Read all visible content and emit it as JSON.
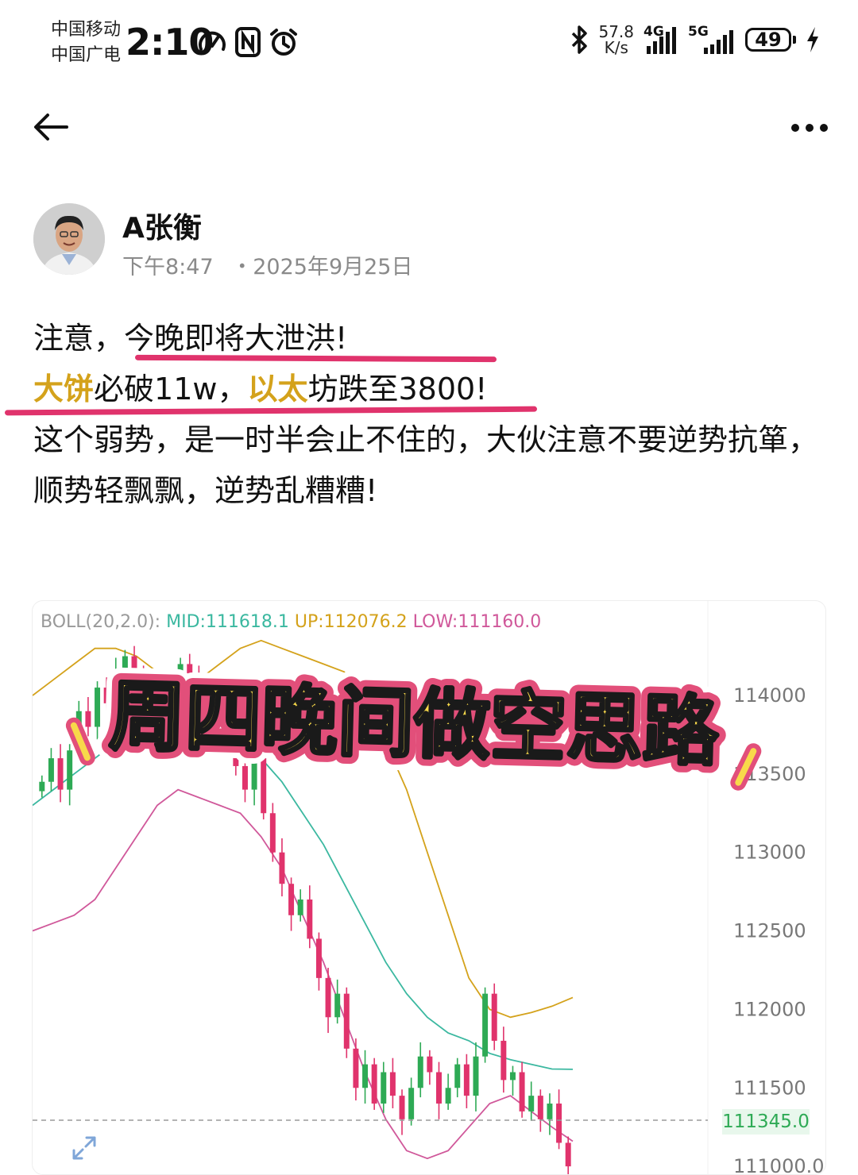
{
  "status_bar": {
    "carrier1": "中国移动",
    "carrier2": "中国广电",
    "time": "2:10",
    "net_speed_value": "57.8",
    "net_speed_unit": "K/s",
    "signal1_label": "4G",
    "signal2_label": "5G",
    "battery": "49"
  },
  "post": {
    "author": "A张衡",
    "time": "下午8:47",
    "date": "・2025年9月25日",
    "line1": "注意，今晚即将大泄洪!",
    "line2_hl1": "大饼",
    "line2_a": "必破11w，",
    "line2_hl2": "以太",
    "line2_b": "坊跌至3800!",
    "line3": "这个弱势，是一时半会止不住的，大伙注意不要逆势抗箪，",
    "line4": "顺势轻飘飘，逆势乱糟糟!"
  },
  "chart": {
    "boll_label": "BOLL(20,2.0):",
    "mid_label": "MID:111618.1",
    "up_label": "UP:112076.2",
    "low_label": "LOW:111160.0",
    "banner_text": "周四晚间做空思路",
    "current_price": "111345.0",
    "colors": {
      "mid": "#3bb8a0",
      "up": "#d4a21b",
      "low": "#d0589a",
      "rise": "#2eaa55",
      "fall": "#e0336c"
    }
  },
  "chart_data": {
    "type": "candlestick",
    "y_axis_ticks": [
      "114000",
      "113500",
      "113000",
      "112500",
      "112000",
      "111500",
      "111000.0"
    ],
    "ylim": [
      110950,
      114450
    ],
    "current_price": 111345.0,
    "boll": {
      "period": 20,
      "k": 2.0,
      "mid": 111618.1,
      "up": 112076.2,
      "low": 111160.0
    },
    "close": [
      113450,
      113600,
      113400,
      113650,
      113900,
      113800,
      114050,
      113950,
      114150,
      114250,
      114100,
      113900,
      114050,
      113850,
      113950,
      114200,
      114100,
      113800,
      113900,
      113750,
      113650,
      113550,
      113400,
      113600,
      113250,
      113000,
      112800,
      112600,
      112700,
      112450,
      112200,
      111950,
      112100,
      111750,
      111500,
      111650,
      111400,
      111600,
      111450,
      111300,
      111500,
      111700,
      111600,
      111400,
      111500,
      111650,
      111450,
      111700,
      112100,
      111800,
      111550,
      111600,
      111350,
      111450,
      111300,
      111400,
      111150,
      111000
    ],
    "up_band": [
      114000,
      114100,
      114200,
      114300,
      114300,
      114250,
      114150,
      114050,
      114100,
      114200,
      114300,
      114350,
      114300,
      114250,
      114200,
      114150,
      114000,
      113700,
      113400,
      113000,
      112600,
      112200,
      112000,
      111950,
      111980,
      112020,
      112076
    ],
    "mid_band": [
      113300,
      113400,
      113500,
      113600,
      113700,
      113750,
      113800,
      113800,
      113780,
      113750,
      113700,
      113600,
      113450,
      113250,
      113050,
      112800,
      112550,
      112300,
      112100,
      111950,
      111850,
      111800,
      111720,
      111680,
      111650,
      111620,
      111618
    ],
    "low_band": [
      112500,
      112550,
      112600,
      112700,
      112900,
      113100,
      113300,
      113400,
      113350,
      113300,
      113250,
      113100,
      112900,
      112600,
      112300,
      111950,
      111600,
      111300,
      111100,
      111050,
      111100,
      111250,
      111400,
      111450,
      111350,
      111250,
      111160
    ]
  }
}
